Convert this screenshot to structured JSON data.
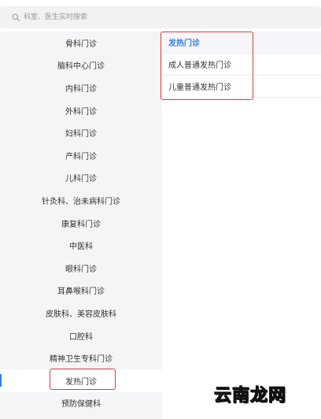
{
  "search": {
    "placeholder": "科室、医生实时搜索",
    "icon": "search-icon"
  },
  "departments": [
    {
      "label": "骨科门诊"
    },
    {
      "label": "脑科中心门诊"
    },
    {
      "label": "内科门诊"
    },
    {
      "label": "外科门诊"
    },
    {
      "label": "妇科门诊"
    },
    {
      "label": "产科门诊"
    },
    {
      "label": "儿科门诊"
    },
    {
      "label": "针灸科、治未病科门诊"
    },
    {
      "label": "康复科门诊"
    },
    {
      "label": "中医科"
    },
    {
      "label": "眼科门诊"
    },
    {
      "label": "耳鼻喉科门诊"
    },
    {
      "label": "皮肤科、美容皮肤科"
    },
    {
      "label": "口腔科"
    },
    {
      "label": "精神卫生专科门诊"
    },
    {
      "label": "发热门诊",
      "selected": true
    },
    {
      "label": "预防保健科"
    }
  ],
  "sub_departments": {
    "header": "发热门诊",
    "items": [
      {
        "label": "成人普通发热门诊"
      },
      {
        "label": "儿童普通发热门诊"
      }
    ]
  },
  "colors": {
    "accent": "#3b7ddd",
    "highlight": "#e53935",
    "sidebar_bg": "#f4f5f7"
  },
  "watermark": "云南龙网"
}
